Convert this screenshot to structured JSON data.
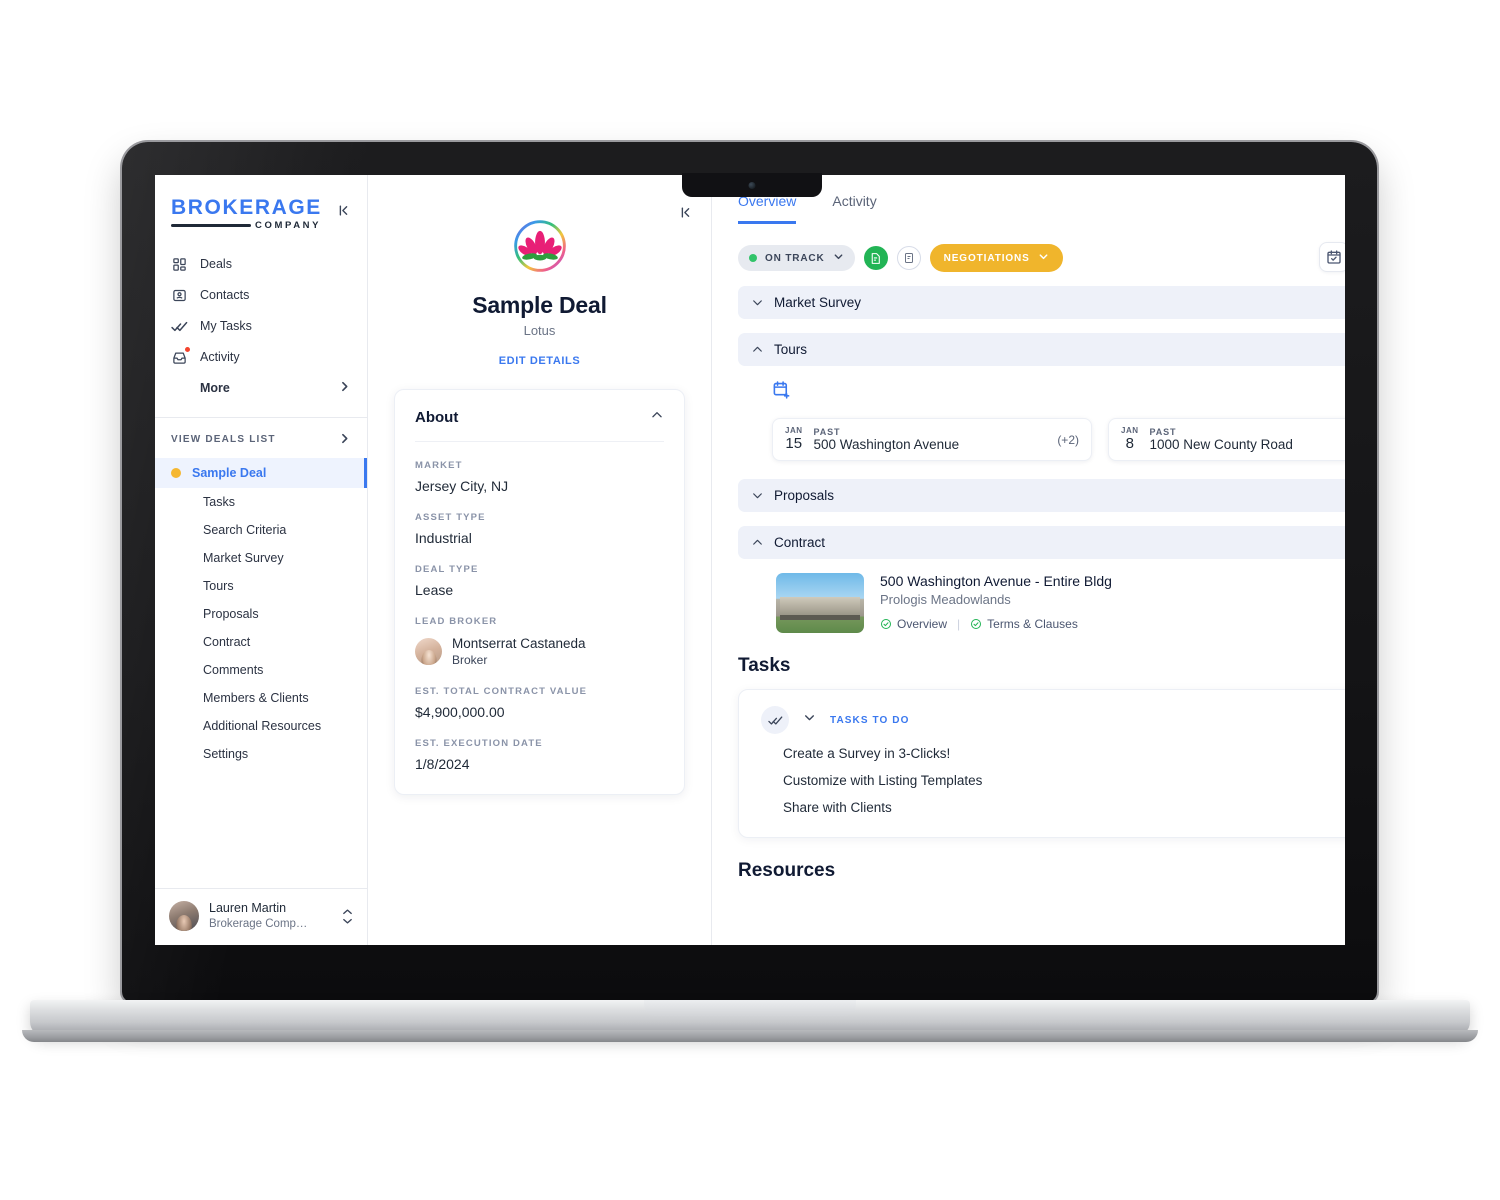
{
  "brand": {
    "main": "BROKERAGE",
    "sub": "COMPANY",
    "collapse_icon": "collapse-left-icon"
  },
  "sidebar": {
    "nav": [
      {
        "label": "Deals",
        "icon": "grid-icon"
      },
      {
        "label": "Contacts",
        "icon": "contact-card-icon"
      },
      {
        "label": "My Tasks",
        "icon": "double-check-icon"
      },
      {
        "label": "Activity",
        "icon": "inbox-icon",
        "badge": true
      }
    ],
    "more_label": "More",
    "deals_list_label": "VIEW DEALS LIST",
    "active_deal": "Sample Deal",
    "active_deal_dot_color": "#f5b731",
    "sub_items": [
      "Tasks",
      "Search Criteria",
      "Market Survey",
      "Tours",
      "Proposals",
      "Contract",
      "Comments",
      "Members & Clients",
      "Additional Resources",
      "Settings"
    ],
    "user": {
      "name": "Lauren Martin",
      "org": "Brokerage Comp…"
    }
  },
  "detail": {
    "logo_icon": "lotus-flower-icon",
    "title": "Sample Deal",
    "subtitle": "Lotus",
    "edit_link": "EDIT DETAILS",
    "about": {
      "heading": "About",
      "fields": [
        {
          "label": "MARKET",
          "value": "Jersey City, NJ"
        },
        {
          "label": "ASSET TYPE",
          "value": "Industrial"
        },
        {
          "label": "DEAL TYPE",
          "value": "Lease"
        }
      ],
      "lead_broker_label": "LEAD BROKER",
      "lead_broker_name": "Montserrat Castaneda",
      "lead_broker_role": "Broker",
      "value_label": "EST. TOTAL CONTRACT VALUE",
      "value_amount": "$4,900,000.00",
      "date_label": "EST. EXECUTION DATE",
      "date_value": "1/8/2024"
    }
  },
  "main": {
    "tabs": [
      {
        "label": "Overview",
        "active": true
      },
      {
        "label": "Activity",
        "active": false
      }
    ],
    "status_chip": "ON TRACK",
    "status_color": "#32c46a",
    "stage_chip": "NEGOTIATIONS",
    "stage_color": "#f0b52c",
    "calendar_button_icon": "calendar-check-icon",
    "sections": [
      {
        "label": "Market Survey",
        "expanded": false
      },
      {
        "label": "Tours",
        "expanded": true
      },
      {
        "label": "Proposals",
        "expanded": false
      },
      {
        "label": "Contract",
        "expanded": true
      }
    ],
    "tours": {
      "add_icon": "calendar-plus-icon",
      "cards": [
        {
          "month": "JAN",
          "day": "15",
          "tag": "PAST",
          "address": "500 Washington Avenue",
          "more": "(+2)"
        },
        {
          "month": "JAN",
          "day": "8",
          "tag": "PAST",
          "address": "1000 New County Road",
          "more": "(+"
        }
      ]
    },
    "contract": {
      "property_name": "500 Washington Avenue - Entire Bldg",
      "owner": "Prologis Meadowlands",
      "links": [
        "Overview",
        "Terms & Clauses"
      ]
    },
    "tasks": {
      "heading": "Tasks",
      "list_label": "TASKS TO DO",
      "items": [
        "Create a Survey in 3-Clicks!",
        "Customize with Listing Templates",
        "Share with Clients"
      ]
    },
    "resources_heading": "Resources"
  }
}
